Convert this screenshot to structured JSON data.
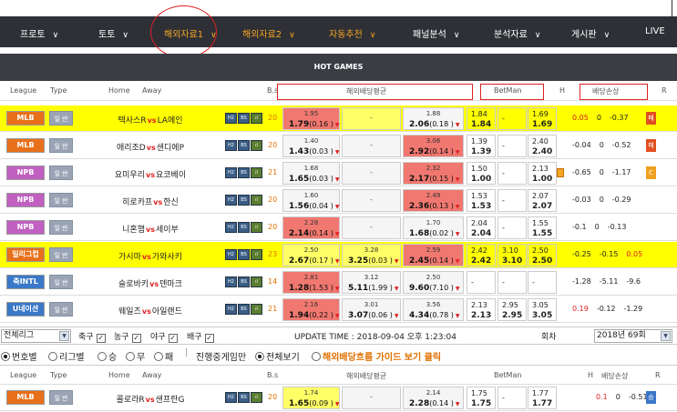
{
  "nav": [
    {
      "label": "프로토",
      "style": "white"
    },
    {
      "label": "토토",
      "style": "white"
    },
    {
      "label": "해외자료1",
      "style": "orange"
    },
    {
      "label": "해외자료2",
      "style": "orange"
    },
    {
      "label": "자동추천",
      "style": "orange"
    },
    {
      "label": "패널분석",
      "style": "white"
    },
    {
      "label": "분석자료",
      "style": "white"
    },
    {
      "label": "게시판",
      "style": "white"
    },
    {
      "label": "LIVE",
      "style": "white"
    }
  ],
  "hot_title": "HOT GAMES",
  "headers": {
    "league": "League",
    "type": "Type",
    "home": "Home",
    "away": "Away",
    "bs": "B.s",
    "overseas": "해외배당평균",
    "betman": "BetMan",
    "h": "H",
    "loss": "배당손상",
    "r": "R"
  },
  "games": [
    {
      "league": "MLB",
      "lcolor": "#e8701a",
      "type": "일 반",
      "home": "텍사스R",
      "away": "LA에인",
      "bs": "20",
      "hl": true,
      "c1": {
        "top": "1.95",
        "bot": "1.79",
        "pct": "(0.16 )",
        "bg": "red"
      },
      "c2": {
        "top": "-",
        "bg": "hl"
      },
      "c3": {
        "top": "1.88",
        "bot": "2.06",
        "pct": "(0.18 )",
        "bg": "gray"
      },
      "bm": [
        [
          "1.84",
          "1.84"
        ],
        [
          "-",
          ""
        ],
        [
          "1.69",
          "1.69"
        ]
      ],
      "hicon": false,
      "loss": [
        "0.05",
        "0",
        "-0.37"
      ],
      "r": "패",
      "rcolor": "#e05020"
    },
    {
      "league": "MLB",
      "lcolor": "#e8701a",
      "type": "일 반",
      "home": "애리조D",
      "away": "샌디에P",
      "bs": "20",
      "hl": false,
      "c1": {
        "top": "1.40",
        "bot": "1.43",
        "pct": "(0.03 )",
        "bg": "gray"
      },
      "c2": {
        "top": "-",
        "bg": "gray"
      },
      "c3": {
        "top": "3.06",
        "bot": "2.92",
        "pct": "(0.14 )",
        "bg": "red"
      },
      "bm": [
        [
          "1.39",
          "1.39"
        ],
        [
          "-",
          ""
        ],
        [
          "2.40",
          "2.40"
        ]
      ],
      "hicon": false,
      "loss": [
        "-0.04",
        "0",
        "-0.52"
      ],
      "r": "패",
      "rcolor": "#e05020"
    },
    {
      "league": "NPB",
      "lcolor": "#c060c0",
      "type": "일 반",
      "home": "요미우리",
      "away": "요코베이",
      "bs": "21",
      "hl": false,
      "c1": {
        "top": "1.68",
        "bot": "1.65",
        "pct": "(0.03 )",
        "bg": "gray"
      },
      "c2": {
        "top": "-",
        "bg": "gray"
      },
      "c3": {
        "top": "2.32",
        "bot": "2.17",
        "pct": "(0.15 )",
        "bg": "red"
      },
      "bm": [
        [
          "1.50",
          "1.00"
        ],
        [
          "-",
          ""
        ],
        [
          "2.13",
          "1.00"
        ]
      ],
      "hicon": true,
      "loss": [
        "-0.65",
        "0",
        "-1.17"
      ],
      "r": "C",
      "rcolor": "#f0a020"
    },
    {
      "league": "NPB",
      "lcolor": "#c060c0",
      "type": "일 반",
      "home": "히로카프",
      "away": "한신",
      "bs": "20",
      "hl": false,
      "c1": {
        "top": "1.60",
        "bot": "1.56",
        "pct": "(0.04 )",
        "bg": "gray"
      },
      "c2": {
        "top": "-",
        "bg": "gray"
      },
      "c3": {
        "top": "2.49",
        "bot": "2.36",
        "pct": "(0.13 )",
        "bg": "red"
      },
      "bm": [
        [
          "1.53",
          "1.53"
        ],
        [
          "-",
          ""
        ],
        [
          "2.07",
          "2.07"
        ]
      ],
      "hicon": false,
      "loss": [
        "-0.03",
        "0",
        "-0.29"
      ],
      "r": "",
      "rcolor": ""
    },
    {
      "league": "NPB",
      "lcolor": "#c060c0",
      "type": "일 반",
      "home": "니혼햄",
      "away": "세이부",
      "bs": "20",
      "hl": false,
      "c1": {
        "top": "2.28",
        "bot": "2.14",
        "pct": "(0.14 )",
        "bg": "red"
      },
      "c2": {
        "top": "-",
        "bg": "gray"
      },
      "c3": {
        "top": "1.70",
        "bot": "1.68",
        "pct": "(0.02 )",
        "bg": "gray"
      },
      "bm": [
        [
          "2.04",
          "2.04"
        ],
        [
          "-",
          ""
        ],
        [
          "1.55",
          "1.55"
        ]
      ],
      "hicon": false,
      "loss": [
        "-0.1",
        "0",
        "-0.13"
      ],
      "r": "",
      "rcolor": ""
    },
    {
      "league": "일리그컵",
      "lcolor": "#e8701a",
      "type": "일 반",
      "home": "가시마",
      "away": "가와사키",
      "bs": "23",
      "hl": true,
      "c1": {
        "top": "2.50",
        "bot": "2.67",
        "pct": "(0.17 )",
        "bg": "hl"
      },
      "c2": {
        "top": "3.28",
        "bot": "3.25",
        "pct": "(0.03 )",
        "bg": "hl"
      },
      "c3": {
        "top": "2.59",
        "bot": "2.45",
        "pct": "(0.14 )",
        "bg": "red"
      },
      "bm": [
        [
          "2.42",
          "2.42"
        ],
        [
          "3.10",
          "3.10"
        ],
        [
          "2.50",
          "2.50"
        ]
      ],
      "hicon": false,
      "loss": [
        "-0.25",
        "-0.15",
        "0.05"
      ],
      "r": "",
      "rcolor": ""
    },
    {
      "league": "축INTL",
      "lcolor": "#3a78c8",
      "type": "일 반",
      "home": "슬로바키",
      "away": "덴마크",
      "bs": "14",
      "hl": false,
      "c1": {
        "top": "2.81",
        "bot": "1.28",
        "pct": "(1.53 )",
        "bg": "red"
      },
      "c2": {
        "top": "3.12",
        "bot": "5.11",
        "pct": "(1.99 )",
        "bg": "gray"
      },
      "c3": {
        "top": "2.50",
        "bot": "9.60",
        "pct": "(7.10 )",
        "bg": "gray"
      },
      "bm": [
        [
          "-",
          ""
        ],
        [
          "-",
          ""
        ],
        [
          "-",
          ""
        ]
      ],
      "hicon": false,
      "loss": [
        "-1.28",
        "-5.11",
        "-9.6"
      ],
      "r": "",
      "rcolor": ""
    },
    {
      "league": "U네이션",
      "lcolor": "#3a78c8",
      "type": "일 반",
      "home": "웨일즈",
      "away": "아일랜드",
      "bs": "21",
      "hl": false,
      "c1": {
        "top": "2.16",
        "bot": "1.94",
        "pct": "(0.22 )",
        "bg": "red"
      },
      "c2": {
        "top": "3.01",
        "bot": "3.07",
        "pct": "(0.06 )",
        "bg": "gray"
      },
      "c3": {
        "top": "3.56",
        "bot": "4.34",
        "pct": "(0.78 )",
        "bg": "gray"
      },
      "bm": [
        [
          "2.13",
          "2.13"
        ],
        [
          "2.95",
          "2.95"
        ],
        [
          "3.05",
          "3.05"
        ]
      ],
      "hicon": false,
      "loss": [
        "0.19",
        "-0.12",
        "-1.29"
      ],
      "r": "",
      "rcolor": ""
    }
  ],
  "filter": {
    "league_select": "전체리그",
    "checks": [
      "축구",
      "농구",
      "야구",
      "배구"
    ],
    "update_time": "UPDATE TIME : 2018-09-04 오후 1:23:04",
    "round_label": "회차",
    "round_value": "2018년 69회"
  },
  "radios": {
    "items": [
      "번호별",
      "리그별",
      "승",
      "무",
      "패"
    ],
    "mode_live": "진행중게임만",
    "mode_all": "전체보기",
    "guide": "해외배당흐름 가이드 보기 클릭"
  },
  "bottom_game": {
    "league": "MLB",
    "lcolor": "#e8701a",
    "type": "일 반",
    "home": "콜로라R",
    "away": "샌프란G",
    "bs": "20",
    "c1": {
      "top": "1.74",
      "bot": "1.65",
      "pct": "(0.09 )",
      "bg": "hl"
    },
    "c2": {
      "top": "-",
      "bg": "gray"
    },
    "c3": {
      "top": "2.14",
      "bot": "2.28",
      "pct": "(0.14 )",
      "bg": "gray"
    },
    "bm": [
      [
        "1.75",
        "1.75"
      ],
      [
        "-",
        ""
      ],
      [
        "1.77",
        "1.77"
      ]
    ],
    "loss": [
      "0.1",
      "0",
      "-0.51"
    ],
    "r": "승",
    "rcolor": "#3a78c8"
  }
}
